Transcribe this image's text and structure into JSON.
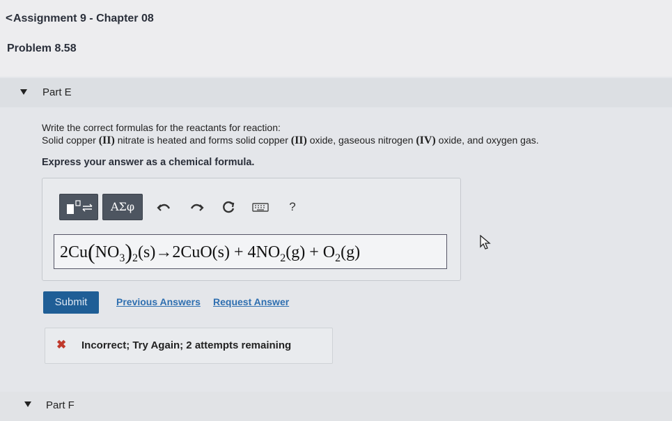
{
  "header": {
    "back_chevron": "<",
    "assignment_title": "Assignment 9 - Chapter 08",
    "problem_title": "Problem 8.58"
  },
  "part_e": {
    "label": "Part E",
    "question_line1": "Write the correct formulas for the reactants for reaction:",
    "q2_a": "Solid copper ",
    "q2_roman1": "(II)",
    "q2_b": " nitrate is heated and forms solid copper ",
    "q2_roman2": "(II)",
    "q2_c": " oxide, gaseous nitrogen ",
    "q2_roman3": "(IV)",
    "q2_d": " oxide, and oxygen gas.",
    "instruction": "Express your answer as a chemical formula."
  },
  "toolbar": {
    "greek_label": "ΑΣφ",
    "help_label": "?",
    "icons": [
      "templates-icon",
      "greek-letters-icon",
      "undo-icon",
      "redo-icon",
      "reset-icon",
      "keyboard-icon",
      "help-icon"
    ]
  },
  "answer": {
    "coef1": "2Cu",
    "no": "NO",
    "sub3": "3",
    "sub2a": "2",
    "state_s1": "(s)",
    "arrow": "→",
    "product1": "2CuO(s)",
    "plus1": " + ",
    "coef2": "4NO",
    "sub2b": "2",
    "state_g1": "(g)",
    "plus2": " + ",
    "o": "O",
    "sub2c": "2",
    "state_g2": "(g)"
  },
  "actions": {
    "submit_label": "Submit",
    "previous_answers": "Previous Answers",
    "request_answer": "Request Answer"
  },
  "feedback": {
    "icon": "✖",
    "message": "Incorrect; Try Again; 2 attempts remaining"
  },
  "part_f": {
    "label": "Part F"
  },
  "colors": {
    "submit_bg": "#1f5e96",
    "link": "#2f6fb0",
    "error": "#c0392b",
    "toolbar_button": "#4d5560"
  }
}
